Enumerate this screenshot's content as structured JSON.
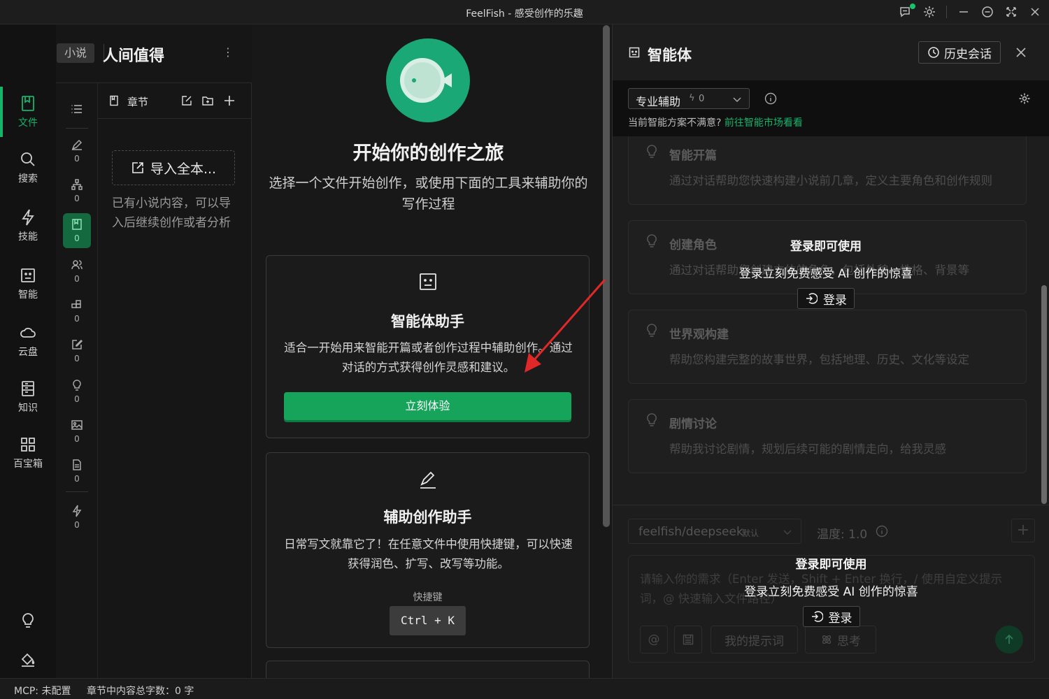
{
  "window": {
    "title": "FeelFish - 感受创作的乐趣"
  },
  "rail": {
    "items": [
      {
        "label": "文件"
      },
      {
        "label": "搜索"
      },
      {
        "label": "技能"
      },
      {
        "label": "智能"
      },
      {
        "label": "云盘"
      },
      {
        "label": "知识"
      },
      {
        "label": "百宝箱"
      }
    ]
  },
  "project": {
    "tag": "小说",
    "title": "人间值得"
  },
  "mini_nav": {
    "counts": [
      "0",
      "0",
      "0",
      "0",
      "0",
      "0",
      "0",
      "0",
      "0",
      "0"
    ]
  },
  "chapters": {
    "header": "章节",
    "import_label": "导入全本...",
    "import_hint": "已有小说内容，可以导入后继续创作或者分析"
  },
  "hero": {
    "title": "开始你的创作之旅",
    "subtitle": "选择一个文件开始创作，或使用下面的工具来辅助你的写作过程"
  },
  "cards": [
    {
      "title": "智能体助手",
      "desc": "适合一开始用来智能开篇或者创作过程中辅助创作。通过对话的方式获得创作灵感和建议。",
      "button": "立刻体验"
    },
    {
      "title": "辅助创作助手",
      "desc": "日常写文就靠它了！在任意文件中使用快捷键，可以快速获得润色、扩写、改写等功能。",
      "shortcut_label": "快捷键",
      "shortcut": "Ctrl + K"
    }
  ],
  "agent": {
    "title": "智能体",
    "history_button": "历史会话",
    "mode": "专业辅助",
    "mode_count": "0",
    "unsatisfied_text": "当前智能方案不满意?",
    "market_link": "前往智能市场看看",
    "suggestions": [
      {
        "title": "智能开篇",
        "desc": "通过对话帮助您快速构建小说前几章，定义主要角色和创作规则"
      },
      {
        "title": "创建角色",
        "desc": "通过对话帮助您创建立体的角色，包括外貌、性格、背景等"
      },
      {
        "title": "世界观构建",
        "desc": "帮助您构建完整的故事世界，包括地理、历史、文化等设定"
      },
      {
        "title": "剧情讨论",
        "desc": "帮助我讨论剧情，规划后续可能的剧情走向，给我灵感"
      }
    ],
    "login_overlay": {
      "title": "登录即可使用",
      "subtitle": "登录立刻免费感受 AI 创作的惊喜",
      "button": "登录"
    },
    "model": "feelfish/deepseek",
    "model_badge": "默认",
    "temperature": "温度: 1.0",
    "input_placeholder": "请输入你的需求（Enter 发送，Shift + Enter 换行，/ 使用自定义提示词，@ 快速输入文件路径）",
    "at_label": "@",
    "prompt_button": "我的提示词",
    "think_button": "思考"
  },
  "status": {
    "mcp": "MCP: 未配置",
    "word_count": "章节中内容总字数：0 字"
  },
  "colors": {
    "accent": "#16b36b",
    "button_green": "#16a35a",
    "logo_bg": "#1aa876"
  }
}
